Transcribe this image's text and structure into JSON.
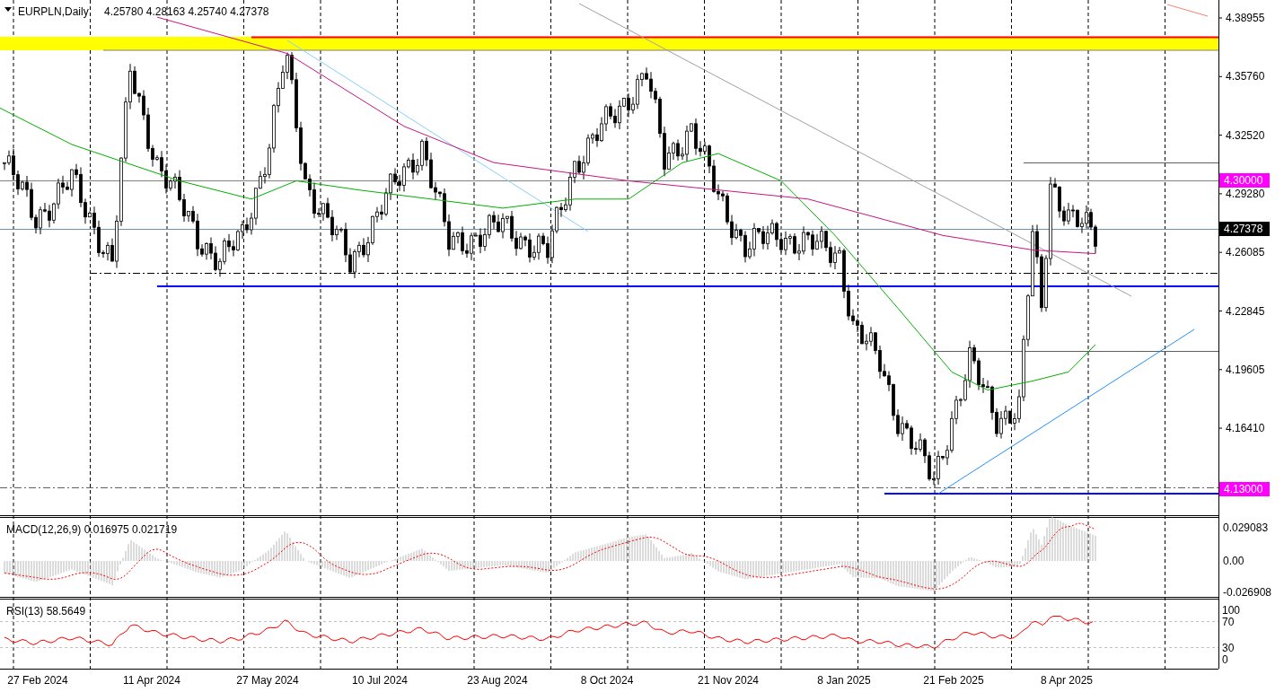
{
  "header": {
    "symbol": "EURPLN,Daily",
    "ohlc": "4.25780 4.28163 4.25740 4.27378"
  },
  "price_axis": [
    "4.38955",
    "4.35760",
    "4.32520",
    "4.29280",
    "4.26085",
    "4.22845",
    "4.19605",
    "4.16410"
  ],
  "price_tags": [
    {
      "text": "4.30000",
      "color": "#ff00ff"
    },
    {
      "text": "4.27378",
      "color": "#000000"
    },
    {
      "text": "4.13000",
      "color": "#ff00ff"
    }
  ],
  "macd": {
    "label": "MACD(12,26,9) 0.016975 0.021719",
    "axis": [
      "0.029083",
      "0.00",
      "-0.026908"
    ]
  },
  "rsi": {
    "label": "RSI(13) 58.5649",
    "axis": [
      "100",
      "70",
      "30",
      "0"
    ]
  },
  "dates": [
    "27 Feb 2024",
    "11 Apr 2024",
    "27 May 2024",
    "10 Jul 2024",
    "23 Aug 2024",
    "8 Oct 2024",
    "21 Nov 2024",
    "8 Jan 2025",
    "21 Feb 2025",
    "8 Apr 2025"
  ]
}
